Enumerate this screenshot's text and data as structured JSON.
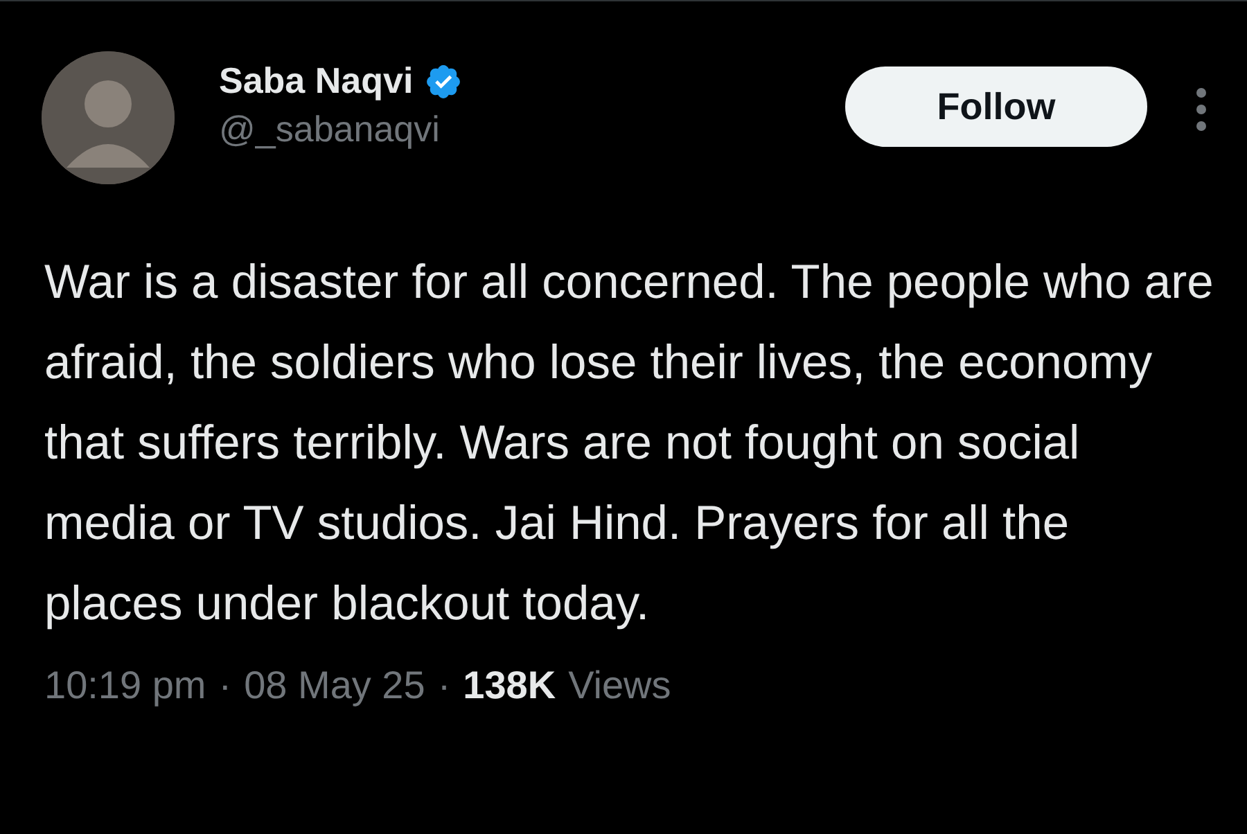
{
  "author": {
    "name": "Saba Naqvi",
    "handle": "@_sabanaqvi",
    "verified": true
  },
  "follow_button": {
    "label": "Follow"
  },
  "tweet": {
    "text": "War is a disaster for all concerned. The people who are afraid, the soldiers who lose their lives, the economy that suffers terribly. Wars are not fought on social media or TV studios. Jai Hind. Prayers for all the places under blackout today."
  },
  "meta": {
    "time": "10:19 pm",
    "separator_1": "·",
    "date": "08 May 25",
    "separator_2": "·",
    "views_count": "138K",
    "views_label": "Views"
  }
}
